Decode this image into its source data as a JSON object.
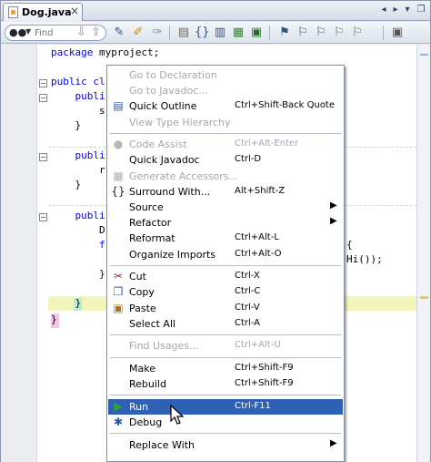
{
  "tab": {
    "title": "Dog.java",
    "close_glyph": "×"
  },
  "window_controls": [
    "◂",
    "▸",
    "▾",
    "❐"
  ],
  "toolbar": {
    "find_placeholder": "Find",
    "icons": [
      "binoculars-icon",
      "find-prev-icon",
      "find-next-icon",
      "toggle-highlight-icon",
      "toggle-rectangular-icon",
      "macro-icon",
      "shift-left-icon",
      "braces-icon",
      "shift-right-icon",
      "format-icon",
      "toggle-bookmark-icon",
      "prev-bookmark-icon",
      "next-bookmark-icon",
      "comment-icon",
      "uncomment-icon",
      "diff-icon",
      "stop-icon"
    ]
  },
  "code_lines": [
    {
      "kw": "package",
      "rest": " myproject;"
    },
    {
      "kw": "",
      "rest": ""
    },
    {
      "kw": "public cl",
      "rest": ""
    },
    {
      "kw": "    publi",
      "rest": ""
    },
    {
      "kw": "",
      "rest": "        s"
    },
    {
      "kw": "",
      "rest": "    }"
    },
    {
      "kw": "",
      "rest": ""
    },
    {
      "kw": "    publi",
      "rest": ""
    },
    {
      "kw": "",
      "rest": "        r"
    },
    {
      "kw": "",
      "rest": "    }"
    },
    {
      "kw": "",
      "rest": ""
    },
    {
      "kw": "    publi",
      "rest": ""
    },
    {
      "kw": "",
      "rest": "        D"
    },
    {
      "kw": "        f",
      "rest": ""
    },
    {
      "kw": "",
      "rest": ""
    },
    {
      "kw": "",
      "rest": "        }"
    },
    {
      "kw": "",
      "rest": ""
    },
    {
      "kw": "",
      "rest": "    }"
    },
    {
      "kw": "",
      "rest": "}"
    }
  ],
  "code_right": {
    "brace": "{",
    "call": "Hi());"
  },
  "menu": {
    "items": [
      {
        "label": "Go to Declaration",
        "accel": "",
        "disabled": true,
        "icon": ""
      },
      {
        "label": "Go to Javadoc...",
        "accel": "",
        "disabled": true,
        "icon": ""
      },
      {
        "label": "Quick Outline",
        "accel": "Ctrl+Shift-Back Quote",
        "disabled": false,
        "icon": "outline-icon"
      },
      {
        "label": "View Type Hierarchy",
        "accel": "",
        "disabled": true,
        "icon": ""
      },
      {
        "sep": true
      },
      {
        "label": "Code Assist",
        "accel": "Ctrl+Alt-Enter",
        "disabled": true,
        "icon": "bulb-icon"
      },
      {
        "label": "Quick Javadoc",
        "accel": "Ctrl-D",
        "disabled": false,
        "icon": ""
      },
      {
        "label": "Generate Accessors...",
        "accel": "",
        "disabled": true,
        "icon": "accessors-icon"
      },
      {
        "label": "Surround With...",
        "accel": "Alt+Shift-Z",
        "disabled": false,
        "icon": "surround-icon"
      },
      {
        "label": "Source",
        "accel": "",
        "disabled": false,
        "icon": "",
        "submenu": true
      },
      {
        "label": "Refactor",
        "accel": "",
        "disabled": false,
        "icon": "",
        "submenu": true
      },
      {
        "label": "Reformat",
        "accel": "Ctrl+Alt-L",
        "disabled": false,
        "icon": ""
      },
      {
        "label": "Organize Imports",
        "accel": "Ctrl+Alt-O",
        "disabled": false,
        "icon": ""
      },
      {
        "sep": true
      },
      {
        "label": "Cut",
        "accel": "Ctrl-X",
        "disabled": false,
        "icon": "scissors-icon"
      },
      {
        "label": "Copy",
        "accel": "Ctrl-C",
        "disabled": false,
        "icon": "copy-icon"
      },
      {
        "label": "Paste",
        "accel": "Ctrl-V",
        "disabled": false,
        "icon": "paste-icon"
      },
      {
        "label": "Select All",
        "accel": "Ctrl-A",
        "disabled": false,
        "icon": ""
      },
      {
        "sep": true
      },
      {
        "label": "Find Usages...",
        "accel": "Ctrl+Alt-U",
        "disabled": true,
        "icon": ""
      },
      {
        "sep": true
      },
      {
        "label": "Make",
        "accel": "Ctrl+Shift-F9",
        "disabled": false,
        "icon": ""
      },
      {
        "label": "Rebuild",
        "accel": "Ctrl+Shift-F9",
        "disabled": false,
        "icon": ""
      },
      {
        "sep": true
      },
      {
        "label": "Run",
        "accel": "Ctrl-F11",
        "disabled": false,
        "icon": "run-icon",
        "selected": true
      },
      {
        "label": "Debug",
        "accel": "",
        "disabled": false,
        "icon": "debug-icon"
      },
      {
        "sep": true
      },
      {
        "label": "Replace With",
        "accel": "",
        "disabled": false,
        "icon": "",
        "submenu": true
      }
    ]
  },
  "colors": {
    "selection": "#2e61b4",
    "keyword": "#0000e6",
    "current_line": "#f2f4bb",
    "disabled_text": "#a4a6ad"
  }
}
